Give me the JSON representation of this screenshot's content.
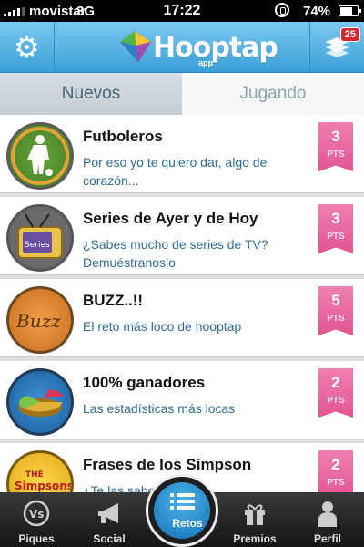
{
  "status_bar": {
    "carrier": "movistar",
    "network": "3G",
    "time": "17:22",
    "battery": "74%",
    "battery_level": 0.74
  },
  "header": {
    "logo_text": "Hooptap",
    "logo_subtext": "app",
    "settings_icon": "gear-icon",
    "menu_icon": "layers-icon",
    "notification_count": "25",
    "colors": {
      "header_top": "#7cc8f0",
      "header_bottom": "#3aa0d8"
    }
  },
  "tabs": [
    {
      "label": "Nuevos",
      "active": true
    },
    {
      "label": "Jugando",
      "active": false
    }
  ],
  "challenges": [
    {
      "title": "Futboleros",
      "description": "Por eso yo te quiero dar, algo de corazón...",
      "points": "3",
      "points_label": "PTS",
      "icon": "soccer-player-icon"
    },
    {
      "title": "Series de Ayer y de Hoy",
      "description": "¿Sabes mucho de series de TV? Demuéstranoslo",
      "points": "3",
      "points_label": "PTS",
      "icon": "tv-icon"
    },
    {
      "title": "BUZZ..!!",
      "description": "El reto más loco de hooptap",
      "points": "5",
      "points_label": "PTS",
      "icon": "buzz-icon"
    },
    {
      "title": "100% ganadores",
      "description": "Las estadísticas más locas",
      "points": "2",
      "points_label": "PTS",
      "icon": "pie-chart-icon"
    },
    {
      "title": "Frases de los Simpson",
      "description": "¿Te las sabes todas?",
      "points": "2",
      "points_label": "PTS",
      "icon": "simpsons-icon"
    }
  ],
  "tabbar": [
    {
      "label": "Piques",
      "icon": "vs-icon"
    },
    {
      "label": "Social",
      "icon": "megaphone-icon"
    },
    {
      "label": "Retos",
      "icon": "list-icon",
      "active": true
    },
    {
      "label": "Premios",
      "icon": "gift-icon"
    },
    {
      "label": "Perfil",
      "icon": "person-icon"
    }
  ]
}
